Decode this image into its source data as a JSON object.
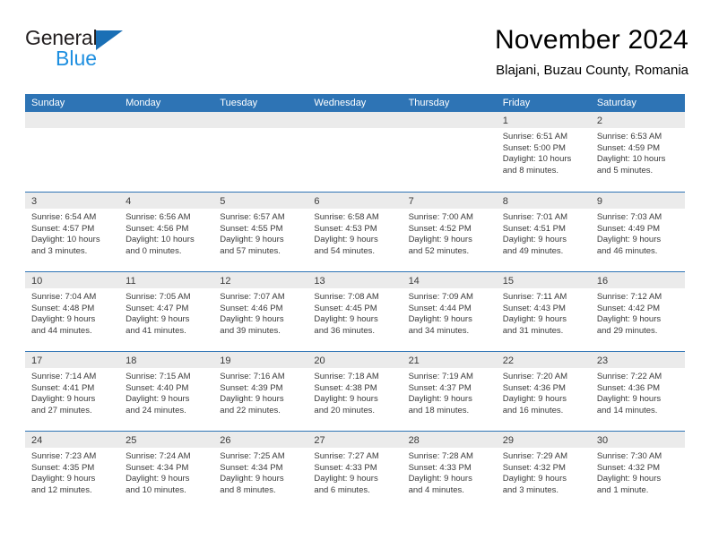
{
  "brand": {
    "name_part1": "General",
    "name_part2": "Blue",
    "logo_icon": "triangle-flag-icon"
  },
  "header": {
    "title": "November 2024",
    "subtitle": "Blajani, Buzau County, Romania"
  },
  "colors": {
    "header_blue": "#2e74b5",
    "day_band_gray": "#ebebeb",
    "brand_blue_light": "#1e8fe0",
    "brand_blue_dark": "#1a6fb5",
    "text": "#3a3a3a"
  },
  "weekday_headers": [
    "Sunday",
    "Monday",
    "Tuesday",
    "Wednesday",
    "Thursday",
    "Friday",
    "Saturday"
  ],
  "weeks": [
    [
      {
        "day": "",
        "blank": true
      },
      {
        "day": "",
        "blank": true
      },
      {
        "day": "",
        "blank": true
      },
      {
        "day": "",
        "blank": true
      },
      {
        "day": "",
        "blank": true
      },
      {
        "day": "1",
        "sunrise": "Sunrise: 6:51 AM",
        "sunset": "Sunset: 5:00 PM",
        "daylight1": "Daylight: 10 hours",
        "daylight2": "and 8 minutes."
      },
      {
        "day": "2",
        "sunrise": "Sunrise: 6:53 AM",
        "sunset": "Sunset: 4:59 PM",
        "daylight1": "Daylight: 10 hours",
        "daylight2": "and 5 minutes."
      }
    ],
    [
      {
        "day": "3",
        "sunrise": "Sunrise: 6:54 AM",
        "sunset": "Sunset: 4:57 PM",
        "daylight1": "Daylight: 10 hours",
        "daylight2": "and 3 minutes."
      },
      {
        "day": "4",
        "sunrise": "Sunrise: 6:56 AM",
        "sunset": "Sunset: 4:56 PM",
        "daylight1": "Daylight: 10 hours",
        "daylight2": "and 0 minutes."
      },
      {
        "day": "5",
        "sunrise": "Sunrise: 6:57 AM",
        "sunset": "Sunset: 4:55 PM",
        "daylight1": "Daylight: 9 hours",
        "daylight2": "and 57 minutes."
      },
      {
        "day": "6",
        "sunrise": "Sunrise: 6:58 AM",
        "sunset": "Sunset: 4:53 PM",
        "daylight1": "Daylight: 9 hours",
        "daylight2": "and 54 minutes."
      },
      {
        "day": "7",
        "sunrise": "Sunrise: 7:00 AM",
        "sunset": "Sunset: 4:52 PM",
        "daylight1": "Daylight: 9 hours",
        "daylight2": "and 52 minutes."
      },
      {
        "day": "8",
        "sunrise": "Sunrise: 7:01 AM",
        "sunset": "Sunset: 4:51 PM",
        "daylight1": "Daylight: 9 hours",
        "daylight2": "and 49 minutes."
      },
      {
        "day": "9",
        "sunrise": "Sunrise: 7:03 AM",
        "sunset": "Sunset: 4:49 PM",
        "daylight1": "Daylight: 9 hours",
        "daylight2": "and 46 minutes."
      }
    ],
    [
      {
        "day": "10",
        "sunrise": "Sunrise: 7:04 AM",
        "sunset": "Sunset: 4:48 PM",
        "daylight1": "Daylight: 9 hours",
        "daylight2": "and 44 minutes."
      },
      {
        "day": "11",
        "sunrise": "Sunrise: 7:05 AM",
        "sunset": "Sunset: 4:47 PM",
        "daylight1": "Daylight: 9 hours",
        "daylight2": "and 41 minutes."
      },
      {
        "day": "12",
        "sunrise": "Sunrise: 7:07 AM",
        "sunset": "Sunset: 4:46 PM",
        "daylight1": "Daylight: 9 hours",
        "daylight2": "and 39 minutes."
      },
      {
        "day": "13",
        "sunrise": "Sunrise: 7:08 AM",
        "sunset": "Sunset: 4:45 PM",
        "daylight1": "Daylight: 9 hours",
        "daylight2": "and 36 minutes."
      },
      {
        "day": "14",
        "sunrise": "Sunrise: 7:09 AM",
        "sunset": "Sunset: 4:44 PM",
        "daylight1": "Daylight: 9 hours",
        "daylight2": "and 34 minutes."
      },
      {
        "day": "15",
        "sunrise": "Sunrise: 7:11 AM",
        "sunset": "Sunset: 4:43 PM",
        "daylight1": "Daylight: 9 hours",
        "daylight2": "and 31 minutes."
      },
      {
        "day": "16",
        "sunrise": "Sunrise: 7:12 AM",
        "sunset": "Sunset: 4:42 PM",
        "daylight1": "Daylight: 9 hours",
        "daylight2": "and 29 minutes."
      }
    ],
    [
      {
        "day": "17",
        "sunrise": "Sunrise: 7:14 AM",
        "sunset": "Sunset: 4:41 PM",
        "daylight1": "Daylight: 9 hours",
        "daylight2": "and 27 minutes."
      },
      {
        "day": "18",
        "sunrise": "Sunrise: 7:15 AM",
        "sunset": "Sunset: 4:40 PM",
        "daylight1": "Daylight: 9 hours",
        "daylight2": "and 24 minutes."
      },
      {
        "day": "19",
        "sunrise": "Sunrise: 7:16 AM",
        "sunset": "Sunset: 4:39 PM",
        "daylight1": "Daylight: 9 hours",
        "daylight2": "and 22 minutes."
      },
      {
        "day": "20",
        "sunrise": "Sunrise: 7:18 AM",
        "sunset": "Sunset: 4:38 PM",
        "daylight1": "Daylight: 9 hours",
        "daylight2": "and 20 minutes."
      },
      {
        "day": "21",
        "sunrise": "Sunrise: 7:19 AM",
        "sunset": "Sunset: 4:37 PM",
        "daylight1": "Daylight: 9 hours",
        "daylight2": "and 18 minutes."
      },
      {
        "day": "22",
        "sunrise": "Sunrise: 7:20 AM",
        "sunset": "Sunset: 4:36 PM",
        "daylight1": "Daylight: 9 hours",
        "daylight2": "and 16 minutes."
      },
      {
        "day": "23",
        "sunrise": "Sunrise: 7:22 AM",
        "sunset": "Sunset: 4:36 PM",
        "daylight1": "Daylight: 9 hours",
        "daylight2": "and 14 minutes."
      }
    ],
    [
      {
        "day": "24",
        "sunrise": "Sunrise: 7:23 AM",
        "sunset": "Sunset: 4:35 PM",
        "daylight1": "Daylight: 9 hours",
        "daylight2": "and 12 minutes."
      },
      {
        "day": "25",
        "sunrise": "Sunrise: 7:24 AM",
        "sunset": "Sunset: 4:34 PM",
        "daylight1": "Daylight: 9 hours",
        "daylight2": "and 10 minutes."
      },
      {
        "day": "26",
        "sunrise": "Sunrise: 7:25 AM",
        "sunset": "Sunset: 4:34 PM",
        "daylight1": "Daylight: 9 hours",
        "daylight2": "and 8 minutes."
      },
      {
        "day": "27",
        "sunrise": "Sunrise: 7:27 AM",
        "sunset": "Sunset: 4:33 PM",
        "daylight1": "Daylight: 9 hours",
        "daylight2": "and 6 minutes."
      },
      {
        "day": "28",
        "sunrise": "Sunrise: 7:28 AM",
        "sunset": "Sunset: 4:33 PM",
        "daylight1": "Daylight: 9 hours",
        "daylight2": "and 4 minutes."
      },
      {
        "day": "29",
        "sunrise": "Sunrise: 7:29 AM",
        "sunset": "Sunset: 4:32 PM",
        "daylight1": "Daylight: 9 hours",
        "daylight2": "and 3 minutes."
      },
      {
        "day": "30",
        "sunrise": "Sunrise: 7:30 AM",
        "sunset": "Sunset: 4:32 PM",
        "daylight1": "Daylight: 9 hours",
        "daylight2": "and 1 minute."
      }
    ]
  ]
}
